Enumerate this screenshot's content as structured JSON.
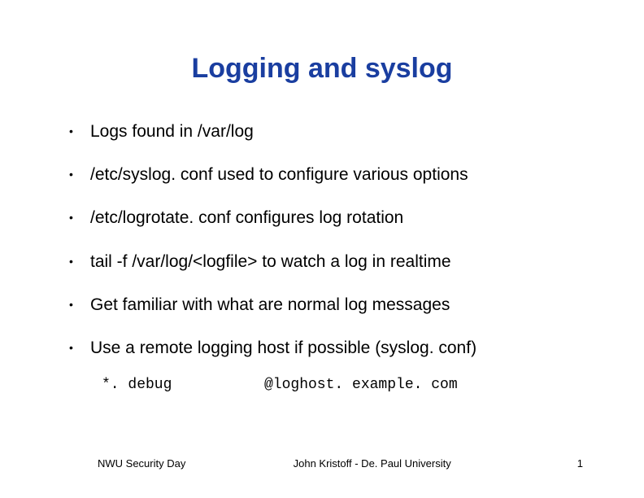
{
  "title": "Logging and syslog",
  "bullets": [
    "Logs found in /var/log",
    "/etc/syslog. conf used to configure various options",
    "/etc/logrotate. conf configures log rotation",
    "tail -f /var/log/<logfile> to watch a log in realtime",
    "Get familiar with what are normal log messages",
    "Use a remote logging host if possible (syslog. conf)"
  ],
  "code": {
    "left": "*. debug",
    "right": "@loghost. example. com"
  },
  "footer": {
    "left": "NWU Security Day",
    "center": "John Kristoff - De. Paul University",
    "right": "1"
  }
}
